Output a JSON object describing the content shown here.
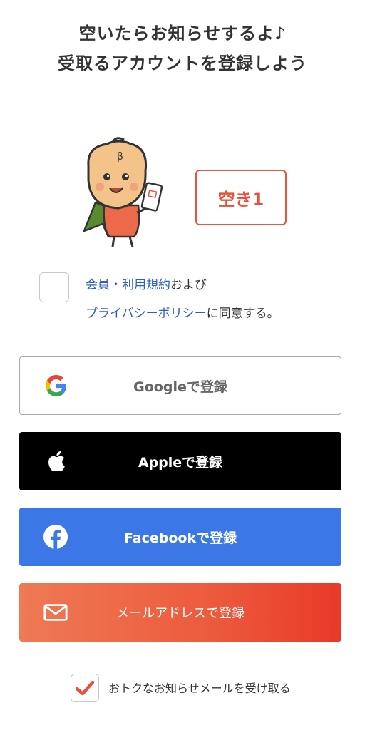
{
  "headline": {
    "line1": "空いたらお知らせするよ♪",
    "line2": "受取るアカウントを登録しよう"
  },
  "status": {
    "label": "空き1",
    "color": "#e8503c"
  },
  "agreement": {
    "terms_link": "会員・利用規約",
    "and_text": "および",
    "privacy_link": "プライバシーポリシー",
    "consent_text": "に同意する。",
    "checked": false
  },
  "buttons": {
    "google": {
      "label": "Googleで登録",
      "icon": "google-g-icon"
    },
    "apple": {
      "label": "Appleで登録",
      "icon": "apple-icon"
    },
    "facebook": {
      "label": "Facebookで登録",
      "icon": "facebook-icon",
      "color": "#3b77e6"
    },
    "email": {
      "label": "メールアドレスで登録",
      "icon": "mail-icon"
    }
  },
  "newsletter": {
    "label": "おトクなお知らせメールを受け取る",
    "checked": true,
    "check_color": "#e8503c"
  }
}
